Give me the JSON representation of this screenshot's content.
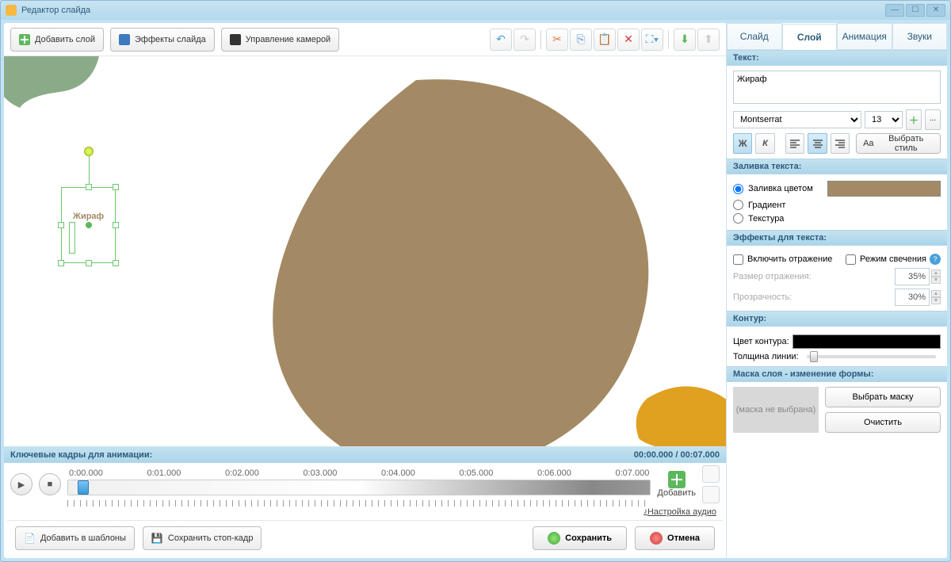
{
  "window": {
    "title": "Редактор слайда"
  },
  "toolbar": {
    "add_layer": "Добавить слой",
    "slide_effects": "Эффекты слайда",
    "camera_control": "Управление камерой"
  },
  "canvas": {
    "selected_text": "Жираф"
  },
  "keyframes": {
    "title": "Ключевые кадры для анимации:",
    "time_current": "00:00.000",
    "time_total": "00:07.000",
    "ticks": [
      "0:00.000",
      "0:01.000",
      "0:02.000",
      "0:03.000",
      "0:04.000",
      "0:05.000",
      "0:06.000",
      "0:07.000"
    ],
    "add_label": "Добавить",
    "audio_link": "Настройка аудио"
  },
  "bottom": {
    "add_template": "Добавить в шаблоны",
    "save_frame": "Сохранить стоп-кадр",
    "save": "Сохранить",
    "cancel": "Отмена"
  },
  "tabs": {
    "slide": "Слайд",
    "layer": "Слой",
    "animation": "Анимация",
    "sounds": "Звуки"
  },
  "panel": {
    "text_head": "Текст:",
    "text_value": "Жираф",
    "font_name": "Montserrat",
    "font_size": "13",
    "bold": "Ж",
    "italic": "К",
    "choose_style": "Выбрать стиль",
    "fill_head": "Заливка текста:",
    "fill_color": "Заливка цветом",
    "fill_gradient": "Градиент",
    "fill_texture": "Текстура",
    "fx_head": "Эффекты для текста:",
    "fx_reflection": "Включить отражение",
    "fx_glow": "Режим свечения",
    "refl_size_label": "Размер отражения:",
    "refl_size_val": "35%",
    "opacity_label": "Прозрачность:",
    "opacity_val": "30%",
    "outline_head": "Контур:",
    "outline_color_label": "Цвет контура:",
    "outline_thick_label": "Толщина линии:",
    "mask_head": "Маска слоя - изменение формы:",
    "mask_empty": "(маска не выбрана)",
    "mask_choose": "Выбрать маску",
    "mask_clear": "Очистить"
  },
  "colors": {
    "text_fill": "#a38a64"
  }
}
